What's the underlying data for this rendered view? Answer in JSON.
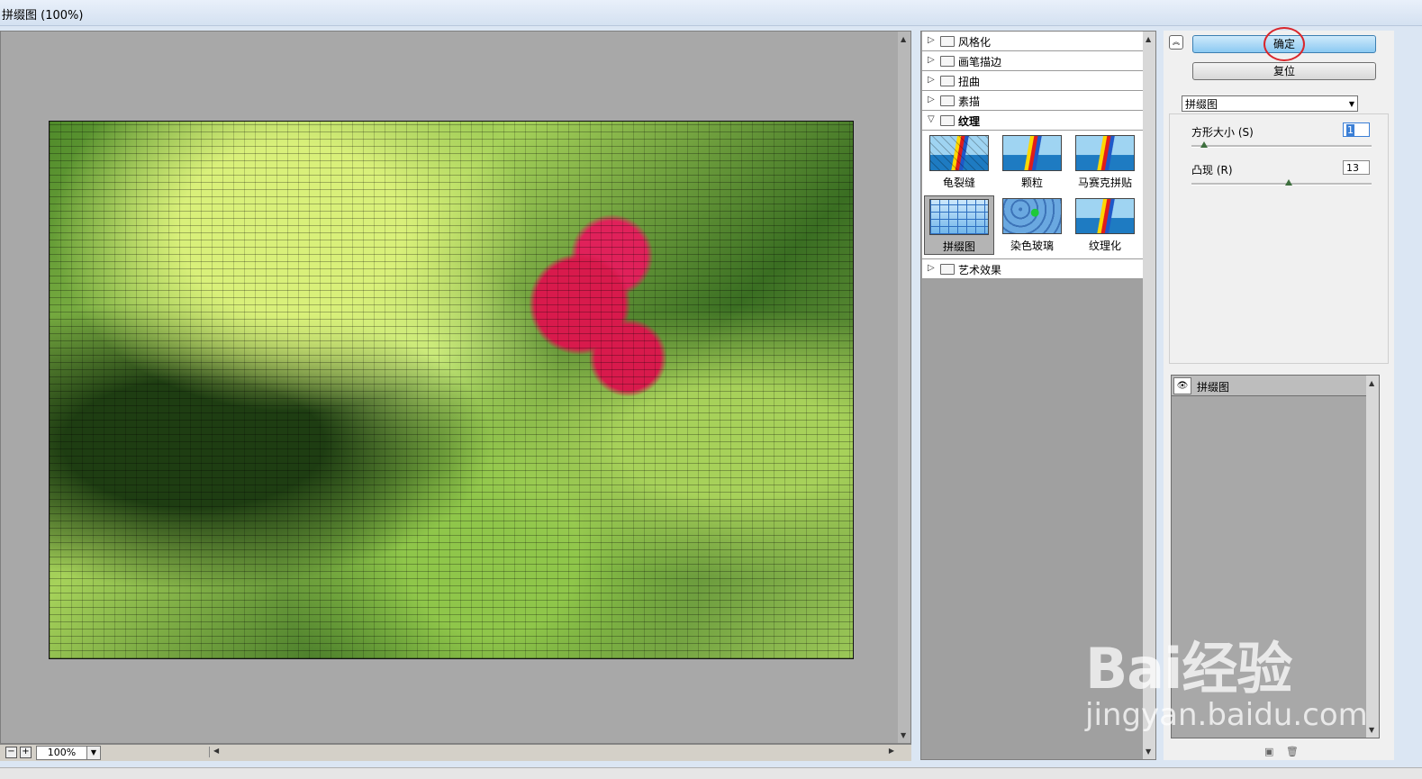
{
  "window": {
    "title": "拼缀图 (100%)"
  },
  "preview": {
    "zoom": "100%",
    "zoom_out_symbol": "−",
    "zoom_in_symbol": "+"
  },
  "filter_gallery": {
    "categories_top": [
      "风格化",
      "画笔描边",
      "扭曲",
      "素描"
    ],
    "open_category": "纹理",
    "thumbnails": [
      "龟裂缝",
      "颗粒",
      "马赛克拼贴",
      "拼缀图",
      "染色玻璃",
      "纹理化"
    ],
    "selected_thumbnail": "拼缀图",
    "categories_bottom": [
      "艺术效果"
    ]
  },
  "settings": {
    "ok_label": "确定",
    "reset_label": "复位",
    "filter_select": "拼缀图",
    "params": [
      {
        "label": "方形大小 (S)",
        "value": "1",
        "level": 0.05
      },
      {
        "label": "凸现 (R)",
        "value": "13",
        "level": 0.52
      }
    ]
  },
  "effect_layers": {
    "items": [
      "拼缀图"
    ]
  },
  "watermark": {
    "brand": "Bai经验",
    "url": "jingyan.baidu.com"
  }
}
